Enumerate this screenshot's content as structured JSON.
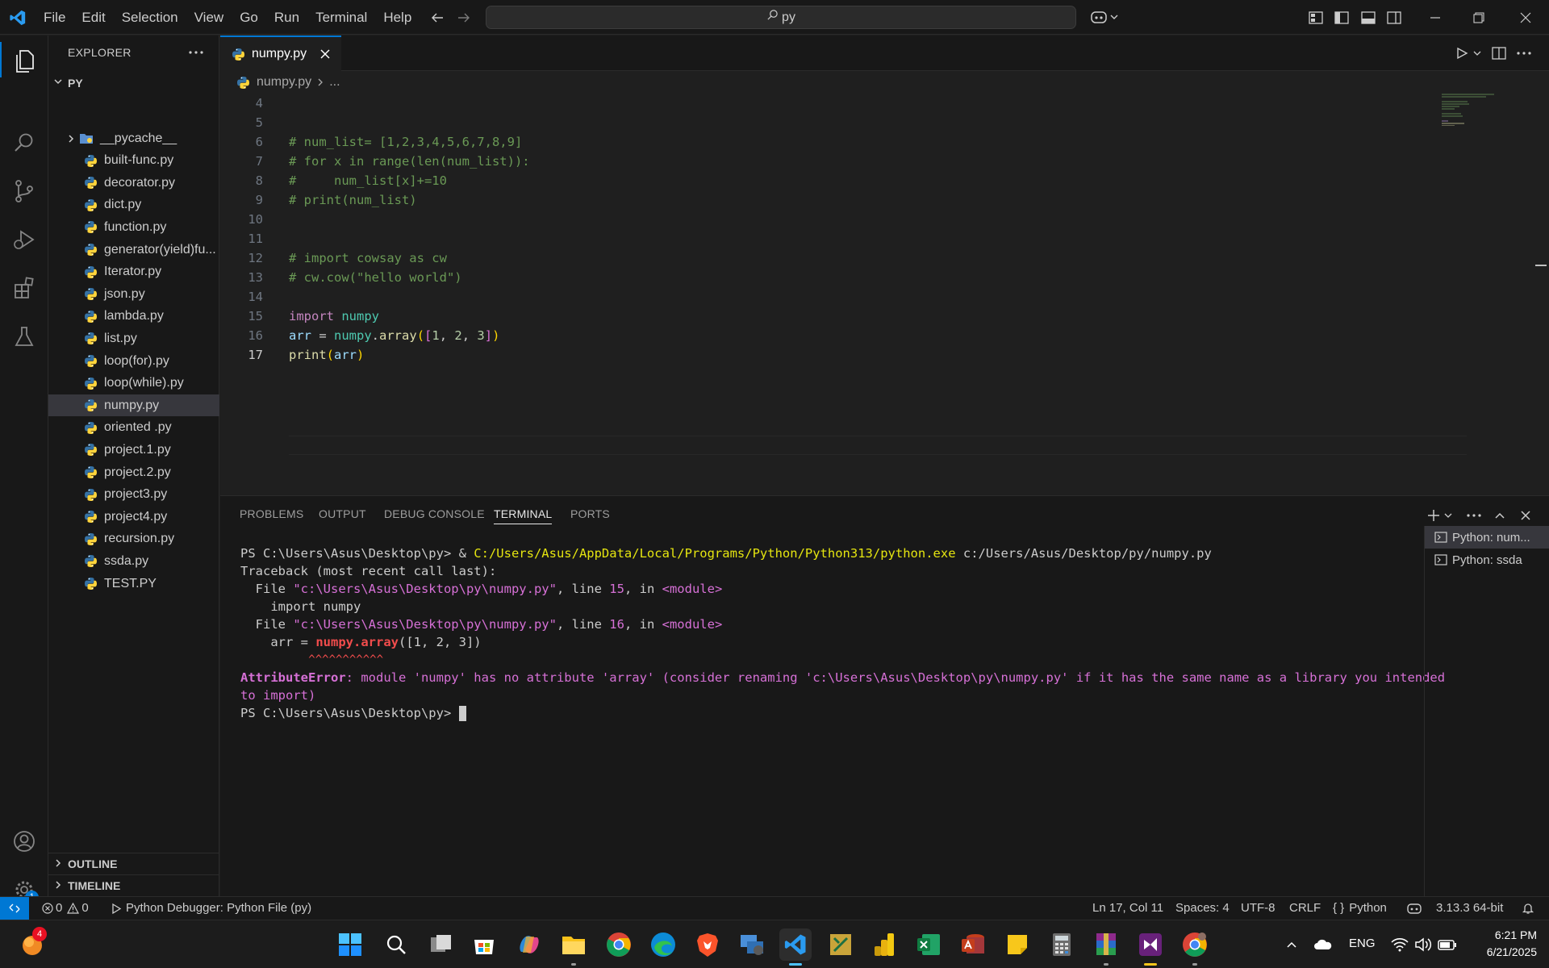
{
  "menu": [
    "File",
    "Edit",
    "Selection",
    "View",
    "Go",
    "Run",
    "Terminal",
    "Help"
  ],
  "search": {
    "text": "py"
  },
  "sidebar": {
    "title": "EXPLORER",
    "folder": "PY",
    "items": [
      {
        "label": "__pycache__",
        "type": "folder"
      },
      {
        "label": "built-func.py"
      },
      {
        "label": "decorator.py"
      },
      {
        "label": "dict.py"
      },
      {
        "label": "function.py"
      },
      {
        "label": "generator(yield)fu..."
      },
      {
        "label": "Iterator.py"
      },
      {
        "label": "json.py"
      },
      {
        "label": "lambda.py"
      },
      {
        "label": "list.py"
      },
      {
        "label": "loop(for).py"
      },
      {
        "label": "loop(while).py"
      },
      {
        "label": "numpy.py",
        "selected": true
      },
      {
        "label": "oriented .py"
      },
      {
        "label": "project.1.py"
      },
      {
        "label": "project.2.py"
      },
      {
        "label": "project3.py"
      },
      {
        "label": "project4.py"
      },
      {
        "label": "recursion.py"
      },
      {
        "label": "ssda.py"
      },
      {
        "label": "TEST.PY"
      }
    ],
    "outline": "OUTLINE",
    "timeline": "TIMELINE"
  },
  "tab": {
    "label": "numpy.py"
  },
  "breadcrumb": {
    "file": "numpy.py",
    "rest": "..."
  },
  "editor": {
    "line_numbers": [
      "4",
      "5",
      "6",
      "7",
      "8",
      "9",
      "10",
      "11",
      "12",
      "13",
      "14",
      "15",
      "16",
      "17"
    ],
    "lines": {
      "l6": "# num_list= [1,2,3,4,5,6,7,8,9]",
      "l7": "# for x in range(len(num_list)):",
      "l8": "#     num_list[x]+=10",
      "l9": "# print(num_list)",
      "l12": "# import cowsay as cw",
      "l13": "# cw.cow(\"hello world\")",
      "l15_kw": "import",
      "l15_mod": "numpy",
      "l16_var": "arr",
      "l16_eq": " = ",
      "l16_mod": "numpy",
      "l16_dot": ".",
      "l16_fn": "array",
      "l16_p1": "(",
      "l16_b1": "[",
      "l16_n1": "1",
      "l16_c1": ", ",
      "l16_n2": "2",
      "l16_c2": ", ",
      "l16_n3": "3",
      "l16_b2": "]",
      "l16_p2": ")",
      "l17_fn": "print",
      "l17_p1": "(",
      "l17_var": "arr",
      "l17_p2": ")"
    }
  },
  "panel": {
    "tabs": [
      "PROBLEMS",
      "OUTPUT",
      "DEBUG CONSOLE",
      "TERMINAL",
      "PORTS"
    ],
    "active_tab": "TERMINAL",
    "terminal": {
      "prompt1": "PS C:\\Users\\Asus\\Desktop\\py> ",
      "cmd_amp": "& ",
      "cmd_exe": "C:/Users/Asus/AppData/Local/Programs/Python/Python313/python.exe",
      "cmd_arg": " c:/Users/Asus/Desktop/py/numpy.py",
      "tb_head": "Traceback (most recent call last):",
      "f1_pre": "  File ",
      "f1_path": "\"c:\\Users\\Asus\\Desktop\\py\\numpy.py\"",
      "f1_mid": ", line ",
      "f1_line": "15",
      "f1_in": ", in ",
      "f1_mod": "<module>",
      "f1_code": "    import numpy",
      "f2_pre": "  File ",
      "f2_path": "\"c:\\Users\\Asus\\Desktop\\py\\numpy.py\"",
      "f2_mid": ", line ",
      "f2_line": "16",
      "f2_in": ", in ",
      "f2_mod": "<module>",
      "f2_code_pre": "    arr = ",
      "f2_code_err": "numpy.array",
      "f2_code_post": "([1, 2, 3])",
      "carets": "          ^^^^^^^^^^^",
      "err_name": "AttributeError",
      "err_msg": ": module 'numpy' has no attribute 'array' (consider renaming 'c:\\Users\\Asus\\Desktop\\py\\numpy.py' if it has the same name as a library you intended",
      "err_msg2": "to import)",
      "prompt2": "PS C:\\Users\\Asus\\Desktop\\py> "
    },
    "terminals": [
      "Python: num...",
      "Python: ssda"
    ]
  },
  "status": {
    "errors": "0",
    "warnings": "0",
    "debugger": "Python Debugger: Python File (py)",
    "position": "Ln 17, Col 11",
    "spaces": "Spaces: 4",
    "encoding": "UTF-8",
    "eol": "CRLF",
    "language": "Python",
    "interpreter": "3.13.3 64-bit"
  },
  "activity_badge": "1",
  "taskbar": {
    "notif_badge": "4",
    "lang": "ENG",
    "time": "6:21 PM",
    "date": "6/21/2025"
  },
  "colors": {
    "accent": "#0078d4",
    "python_blue": "#3572A5",
    "python_yellow": "#FFD43B"
  }
}
